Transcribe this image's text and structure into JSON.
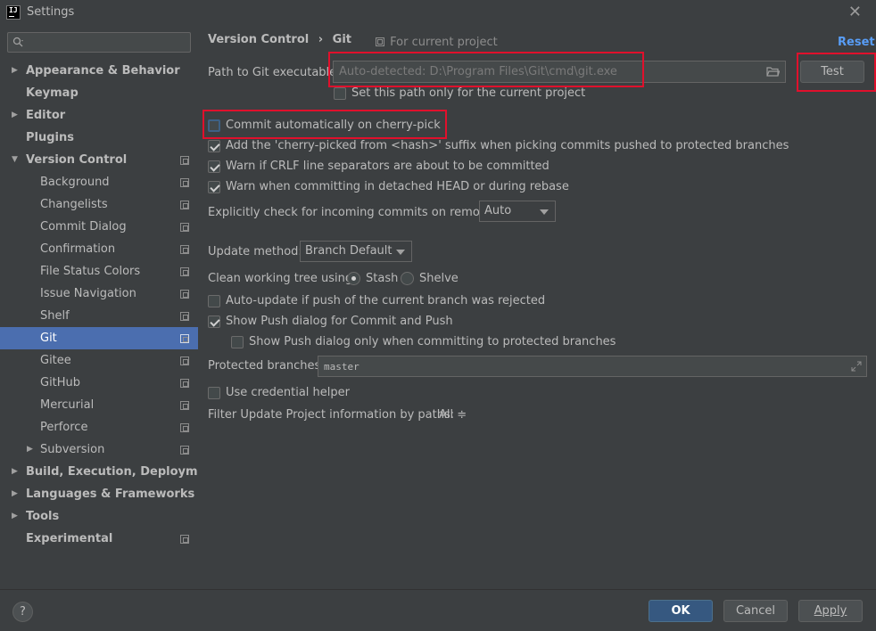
{
  "window": {
    "title": "Settings",
    "logo_text": "IJ",
    "close_symbol": "✕"
  },
  "search": {
    "placeholder": "",
    "icon": "search-icon"
  },
  "sidebar": {
    "items": [
      {
        "label": "Appearance & Behavior",
        "expandable": true,
        "expanded": false,
        "bold": true,
        "project_icon": false
      },
      {
        "label": "Keymap",
        "expandable": false,
        "bold": true,
        "project_icon": false
      },
      {
        "label": "Editor",
        "expandable": true,
        "expanded": false,
        "bold": true,
        "project_icon": false
      },
      {
        "label": "Plugins",
        "expandable": false,
        "bold": true,
        "project_icon": false
      },
      {
        "label": "Version Control",
        "expandable": true,
        "expanded": true,
        "bold": true,
        "project_icon": true
      },
      {
        "label": "Background",
        "child": true,
        "project_icon": true
      },
      {
        "label": "Changelists",
        "child": true,
        "project_icon": true
      },
      {
        "label": "Commit Dialog",
        "child": true,
        "project_icon": true
      },
      {
        "label": "Confirmation",
        "child": true,
        "project_icon": true
      },
      {
        "label": "File Status Colors",
        "child": true,
        "project_icon": true
      },
      {
        "label": "Issue Navigation",
        "child": true,
        "project_icon": true
      },
      {
        "label": "Shelf",
        "child": true,
        "project_icon": true
      },
      {
        "label": "Git",
        "child": true,
        "project_icon": true,
        "selected": true
      },
      {
        "label": "Gitee",
        "child": true,
        "project_icon": true
      },
      {
        "label": "GitHub",
        "child": true,
        "project_icon": true
      },
      {
        "label": "Mercurial",
        "child": true,
        "project_icon": true
      },
      {
        "label": "Perforce",
        "child": true,
        "project_icon": true
      },
      {
        "label": "Subversion",
        "child": true,
        "expandable": true,
        "project_icon": true
      },
      {
        "label": "Build, Execution, Deployment",
        "expandable": true,
        "bold": true,
        "project_icon": false
      },
      {
        "label": "Languages & Frameworks",
        "expandable": true,
        "bold": true,
        "project_icon": false
      },
      {
        "label": "Tools",
        "expandable": true,
        "bold": true,
        "project_icon": false
      },
      {
        "label": "Experimental",
        "expandable": false,
        "bold": true,
        "project_icon": true
      }
    ]
  },
  "header": {
    "breadcrumb_parent": "Version Control",
    "breadcrumb_sep": "›",
    "breadcrumb_current": "Git",
    "for_project": "For current project",
    "reset_label": "Reset"
  },
  "git": {
    "path_label": "Path to Git executable:",
    "path_placeholder": "Auto-detected: D:\\Program Files\\Git\\cmd\\git.exe",
    "test_label": "Test",
    "set_path_only_label": "Set this path only for the current project",
    "set_path_only_checked": false,
    "commit_cherry_pick_label": "Commit automatically on cherry-pick",
    "commit_cherry_pick_checked": false,
    "cherry_suffix_label": "Add the 'cherry-picked from <hash>' suffix when picking commits pushed to protected branches",
    "cherry_suffix_checked": true,
    "crlf_label": "Warn if CRLF line separators are about to be committed",
    "crlf_checked": true,
    "detached_label": "Warn when committing in detached HEAD or during rebase",
    "detached_checked": true,
    "incoming_label": "Explicitly check for incoming commits on remotes:",
    "incoming_value": "Auto",
    "update_method_label": "Update method:",
    "update_method_value": "Branch Default",
    "clean_tree_label": "Clean working tree using:",
    "stash_label": "Stash",
    "stash_checked": true,
    "shelve_label": "Shelve",
    "shelve_checked": false,
    "auto_update_label": "Auto-update if push of the current branch was rejected",
    "auto_update_checked": false,
    "show_push_label": "Show Push dialog for Commit and Push",
    "show_push_checked": true,
    "show_push_protected_label": "Show Push dialog only when committing to protected branches",
    "show_push_protected_checked": false,
    "protected_label": "Protected branches:",
    "protected_value": "master",
    "credential_label": "Use credential helper",
    "credential_checked": false,
    "filter_label": "Filter Update Project information by paths:",
    "filter_value": "All ≑"
  },
  "footer": {
    "help_label": "?",
    "ok_label": "OK",
    "cancel_label": "Cancel",
    "apply_label": "Apply"
  },
  "colors": {
    "background": "#3c3f41",
    "selection": "#4b6eaf",
    "link": "#589df6",
    "highlight_box": "#e0102c",
    "primary_button": "#365880"
  }
}
